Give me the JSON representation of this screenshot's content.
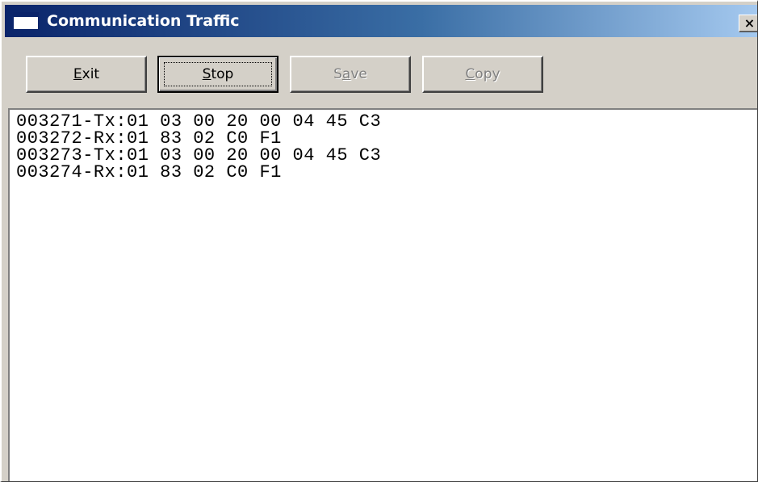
{
  "window": {
    "title": "Communication Traffic",
    "close_label": "×"
  },
  "toolbar": {
    "exit": {
      "pre": "",
      "key": "E",
      "post": "xit",
      "enabled": true
    },
    "stop": {
      "pre": "",
      "key": "S",
      "post": "top",
      "enabled": true,
      "default": true
    },
    "save": {
      "pre": "S",
      "key": "a",
      "post": "ve",
      "enabled": false
    },
    "copy": {
      "pre": "",
      "key": "C",
      "post": "opy",
      "enabled": false
    }
  },
  "log": {
    "lines": [
      "003271-Tx:01 03 00 20 00 04 45 C3",
      "003272-Rx:01 83 02 C0 F1",
      "003273-Tx:01 03 00 20 00 04 45 C3",
      "003274-Rx:01 83 02 C0 F1"
    ]
  },
  "colors": {
    "titlebar_start": "#0a246a",
    "titlebar_end": "#a6caf0",
    "face": "#d4d0c8"
  }
}
